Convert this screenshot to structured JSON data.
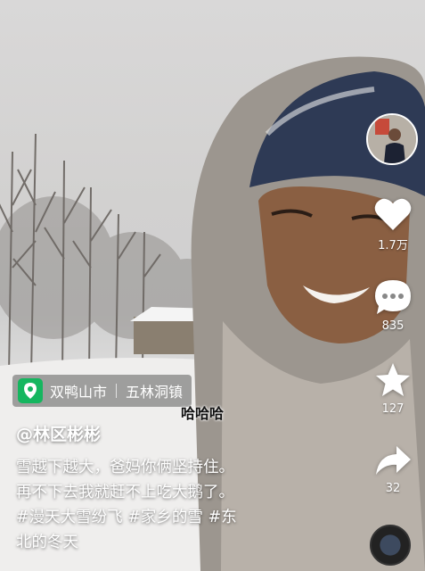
{
  "scene": {
    "description_icon": "snowy-forest-video"
  },
  "rail": {
    "likes": "1.7万",
    "comments": "835",
    "favorites": "127",
    "shares": "32"
  },
  "location": {
    "city": "双鸭山市",
    "town": "五林洞镇"
  },
  "subtitle": "哈哈哈",
  "author": "@林区彬彬",
  "description": {
    "line1": "雪越下越大，爸妈你俩坚持住。",
    "line2": "再不下去我就赶不上吃大鹅了。",
    "line3": "#漫天大雪纷飞 #家乡的雪 #东",
    "line4": "北的冬天"
  },
  "colors": {
    "location_pin": "#15b65f",
    "like": "#ffffff"
  }
}
